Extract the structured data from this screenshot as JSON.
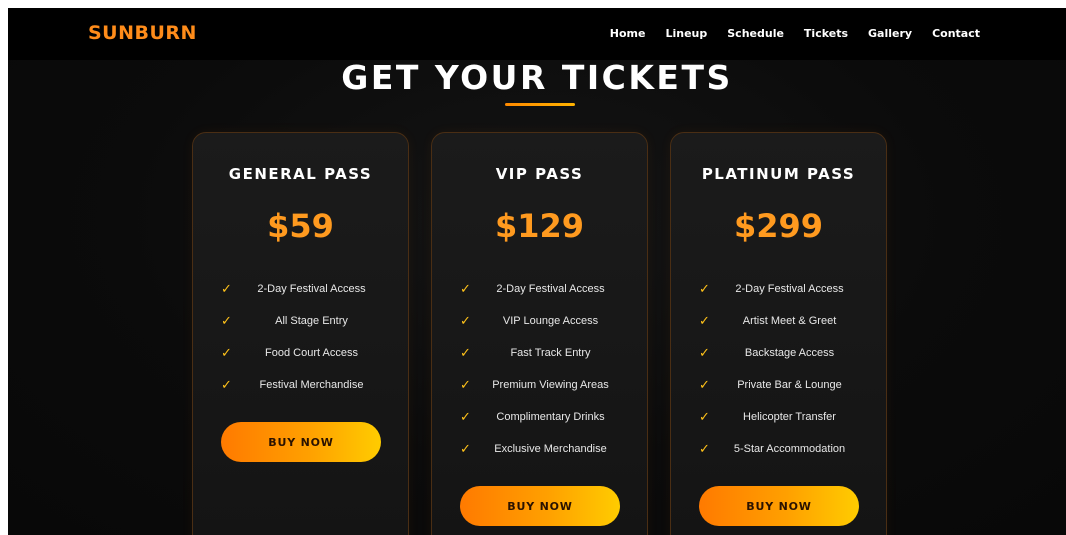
{
  "brand": "SUNBURN",
  "nav": [
    "Home",
    "Lineup",
    "Schedule",
    "Tickets",
    "Gallery",
    "Contact"
  ],
  "section_title": "GET YOUR TICKETS",
  "colors": {
    "accent": "#ff8c1a",
    "price": "#ff9a1f",
    "check": "#ffc21a",
    "background": "#0b0b0b"
  },
  "cards": [
    {
      "name": "GENERAL PASS",
      "price": "$59",
      "features": [
        "2-Day Festival Access",
        "All Stage Entry",
        "Food Court Access",
        "Festival Merchandise"
      ],
      "button": "BUY NOW"
    },
    {
      "name": "VIP PASS",
      "price": "$129",
      "features": [
        "2-Day Festival Access",
        "VIP Lounge Access",
        "Fast Track Entry",
        "Premium Viewing Areas",
        "Complimentary Drinks",
        "Exclusive Merchandise"
      ],
      "button": "BUY NOW"
    },
    {
      "name": "PLATINUM PASS",
      "price": "$299",
      "features": [
        "2-Day Festival Access",
        "Artist Meet & Greet",
        "Backstage Access",
        "Private Bar & Lounge",
        "Helicopter Transfer",
        "5-Star Accommodation"
      ],
      "button": "BUY NOW"
    }
  ],
  "check_glyph": "✓"
}
